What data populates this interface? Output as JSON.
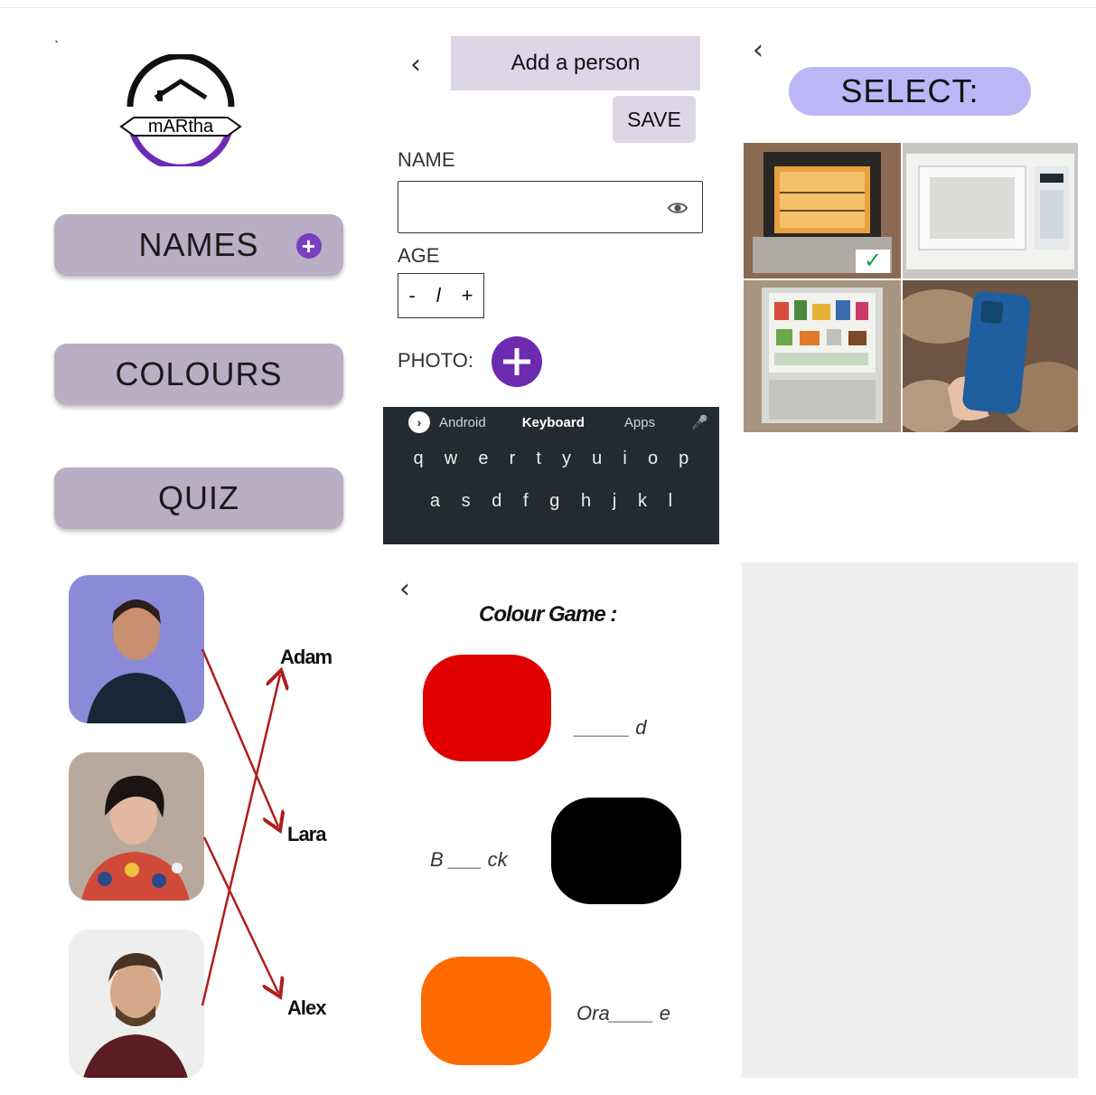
{
  "home": {
    "logo_text": "mARtha",
    "menu": [
      {
        "label": "NAMES"
      },
      {
        "label": "COLOURS"
      },
      {
        "label": "QUIZ"
      }
    ],
    "accent": "#7a3fbf",
    "button_color": "#b9aec4"
  },
  "add_person": {
    "back_icon": "chevron-left-icon",
    "title": "Add a person",
    "save_label": "SAVE",
    "name_label": "NAME",
    "name_value": "",
    "age_label": "AGE",
    "age_minus": "-",
    "age_value": "l",
    "age_plus": "+",
    "photo_label": "PHOTO:",
    "keyboard": {
      "tabs": [
        "Android",
        "Keyboard",
        "Apps"
      ],
      "row1": [
        "q",
        "w",
        "e",
        "r",
        "t",
        "y",
        "u",
        "i",
        "o",
        "p"
      ],
      "row2": [
        "a",
        "s",
        "d",
        "f",
        "g",
        "h",
        "j",
        "k",
        "l"
      ]
    }
  },
  "select": {
    "back_icon": "chevron-left-icon",
    "title": "SELECT:",
    "check": "✓"
  },
  "names_match": {
    "names": [
      "Adam",
      "Lara",
      "Alex"
    ],
    "arrow_color": "#b01c1c"
  },
  "colour_game": {
    "back_icon": "chevron-left-icon",
    "title": "Colour Game :",
    "items": [
      {
        "color": "#e00000",
        "prompt": "_____ d"
      },
      {
        "color": "#000000",
        "prompt": "B ___ ck"
      },
      {
        "color": "#ff6a00",
        "prompt": "Ora____ e"
      }
    ]
  }
}
